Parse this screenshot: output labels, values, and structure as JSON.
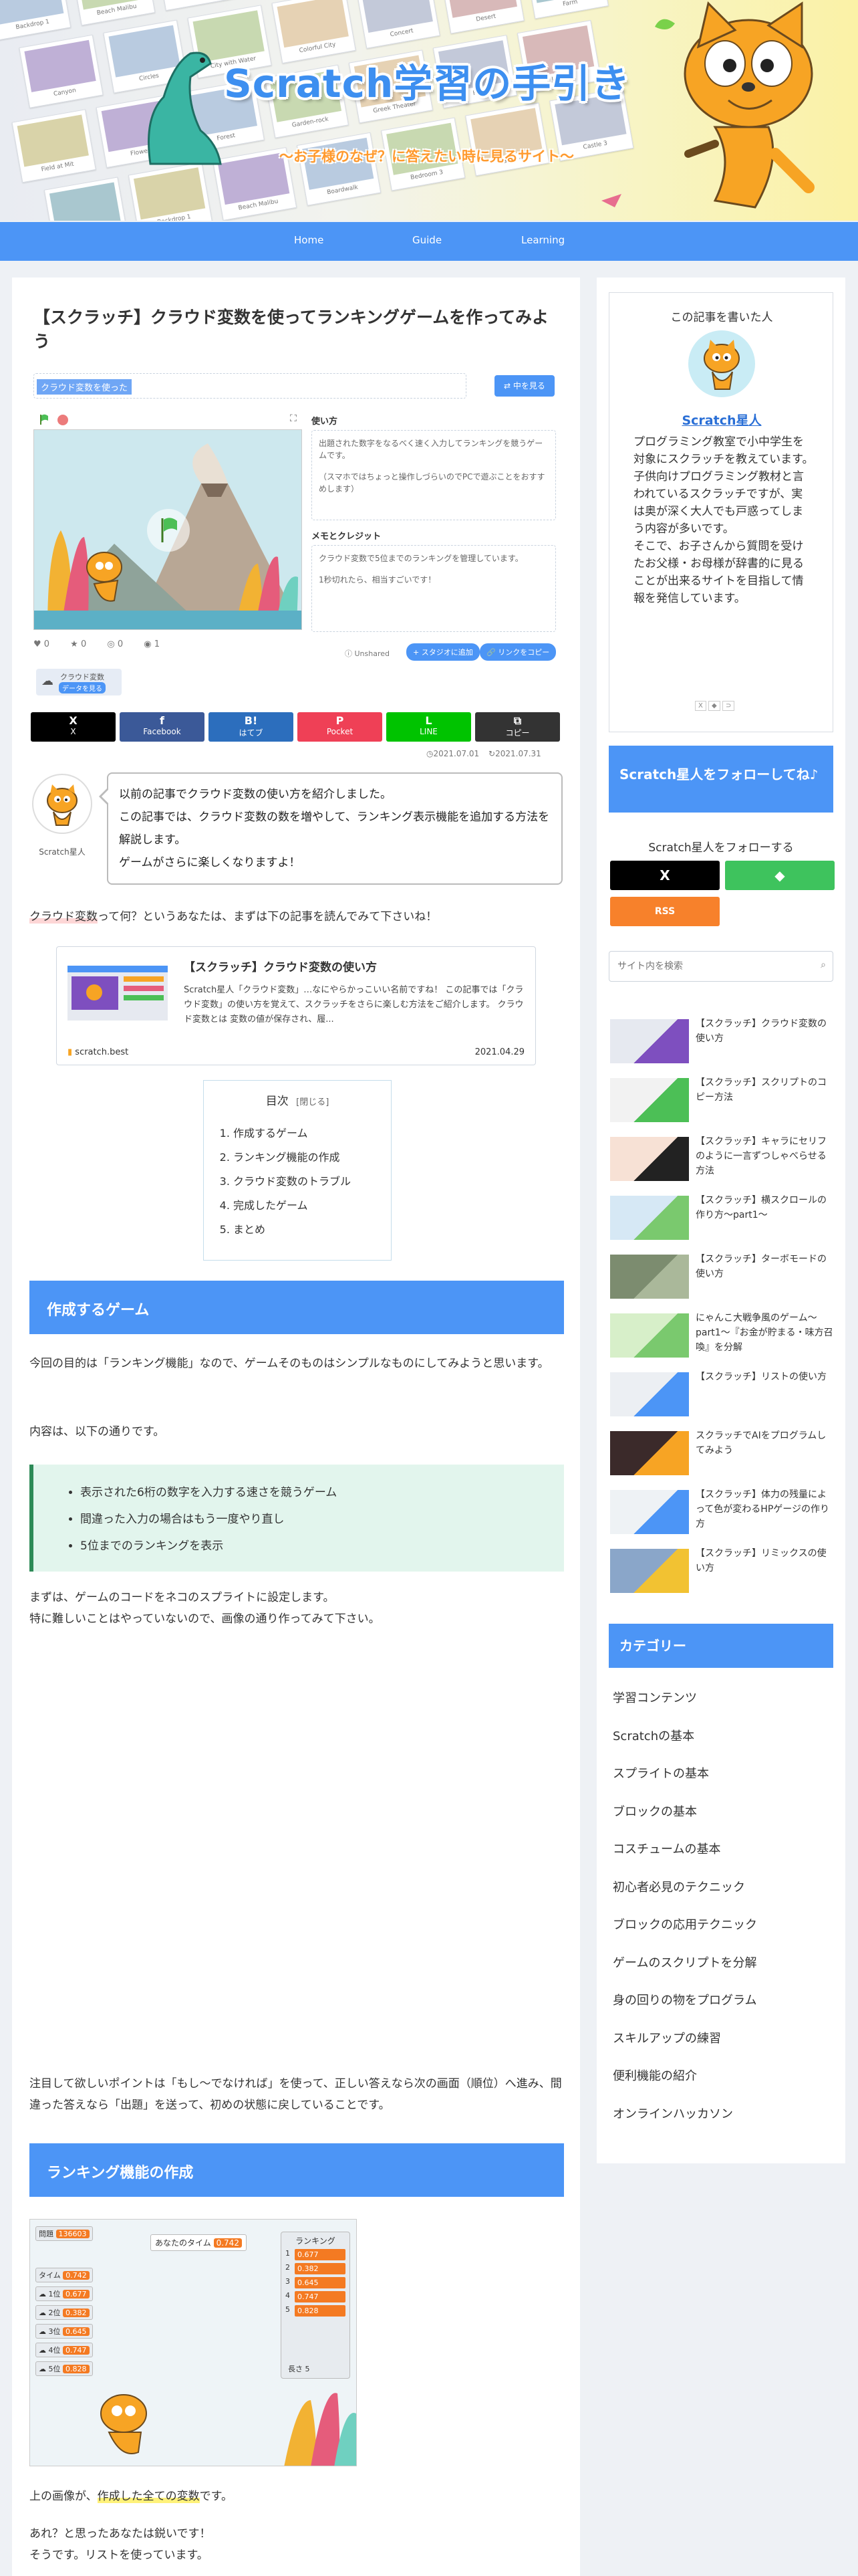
{
  "header": {
    "title": "Scratch学習の手引き",
    "subtitle": "～お子様のなぜ？に答えたい時に見るサイト～",
    "nav": [
      "Home",
      "Guide",
      "Learning"
    ],
    "tile_labels": [
      "Backdrop 1",
      "Beach Malibu",
      "Boardwalk",
      "Bedroom 3",
      "Castle 4",
      "Castle 3",
      "Chalkboard",
      "Canyon",
      "Circles",
      "City with Water",
      "Colorful City",
      "Concert",
      "Desert",
      "Farm",
      "Field at Mit",
      "Flowers",
      "Forest",
      "Garden-rock",
      "Greek Theater",
      "Hall",
      "Jurassic",
      "Light"
    ]
  },
  "article": {
    "title": "【スクラッチ】クラウド変数を使ってランキングゲームを作ってみよう",
    "embed": {
      "project_name": "ランキング",
      "selected_text": "クラウド変数を使った",
      "remix_label": "中を見る",
      "instructions_title": "使い方",
      "instructions_text": "出題された数字をなるべく速く入力してランキングを競うゲームです。",
      "instructions_note": "（スマホではちょっと操作しづらいのでPCで遊ぶことをおすすめします）",
      "credits_title": "メモとクレジット",
      "credits_text": "クラウド変数で5位までのランキングを管理しています。",
      "credits_note": "1秒切れたら、相当すごいです！",
      "stats": [
        "0",
        "0",
        "0",
        "1"
      ],
      "unshared": "Unshared",
      "studio_button": "スタジオに追加",
      "copy_link_button": "リンクをコピー",
      "tag": "クラウド変数",
      "tag_sub": "データを見る"
    },
    "share": [
      {
        "icon": "X",
        "label": "X",
        "color": "#000000"
      },
      {
        "icon": "f",
        "label": "Facebook",
        "color": "#3b5998"
      },
      {
        "icon": "B!",
        "label": "はてブ",
        "color": "#2c6ebd"
      },
      {
        "icon": "P",
        "label": "Pocket",
        "color": "#ef4056"
      },
      {
        "icon": "L",
        "label": "LINE",
        "color": "#00c300"
      },
      {
        "icon": "⧉",
        "label": "コピー",
        "color": "#333333"
      }
    ],
    "date_posted": "2021.07.01",
    "date_updated": "2021.07.31",
    "speaker_name": "Scratch星人",
    "bubble": [
      "以前の記事でクラウド変数の使い方を紹介しました。",
      "この記事では、クラウド変数の数を増やして、ランキング表示機能を追加する方法を解説します。",
      "ゲームがさらに楽しくなりますよ！"
    ],
    "intro_highlight": "クラウド変数",
    "intro_rest": "って何？というあなたは、まずは下の記事を読んでみて下さいね！",
    "card": {
      "title": "【スクラッチ】クラウド変数の使い方",
      "excerpt": "Scratch星人「クラウド変数」…なにやらかっこいい名前ですね！ この記事では「クラウド変数」の使い方を覚えて、スクラッチをさらに楽しむ方法をご紹介します。 クラウド変数とは 変数の値が保存され、履...",
      "domain": "scratch.best",
      "date": "2021.04.29"
    },
    "toc": {
      "title": "目次",
      "toggle": "[閉じる]",
      "items": [
        "作成するゲーム",
        "ランキング機能の作成",
        "クラウド変数のトラブル",
        "完成したゲーム",
        "まとめ"
      ]
    },
    "h2_1": "作成するゲーム",
    "p1": "今回の目的は「ランキング機能」なので、ゲームそのものはシンプルなものにしてみようと思います。",
    "p2": "内容は、以下の通りです。",
    "bullets": [
      "表示された6桁の数字を入力する速さを競うゲーム",
      "間違った入力の場合はもう一度やり直し",
      "5位までのランキングを表示"
    ],
    "p3a": "まずは、ゲームのコードをネコのスプライトに設定します。",
    "p3b": "特に難しいことはやっていないので、画像の通り作ってみて下さい。",
    "p4": "注目して欲しいポイントは「もし～でなければ」を使って、正しい答えなら次の画面（順位）へ進み、間違った答えなら「出題」を送って、初めの状態に戻していることです。",
    "h2_2": "ランキング機能の作成",
    "shot": {
      "q_label": "問題",
      "q_value": "136603",
      "your_time_label": "あなたのタイム",
      "your_time_value": "0.742",
      "time_label": "タイム",
      "time_value": "0.742",
      "ranking_title": "ランキング",
      "ranks": [
        {
          "n": "1",
          "v": "0.677"
        },
        {
          "n": "2",
          "v": "0.382"
        },
        {
          "n": "3",
          "v": "0.645"
        },
        {
          "n": "4",
          "v": "0.747"
        },
        {
          "n": "5",
          "v": "0.828"
        }
      ],
      "left_rows": [
        {
          "label": "1位",
          "value": "0.677"
        },
        {
          "label": "2位",
          "value": "0.382"
        },
        {
          "label": "3位",
          "value": "0.645"
        },
        {
          "label": "4位",
          "value": "0.747"
        },
        {
          "label": "5位",
          "value": "0.828"
        }
      ],
      "length_label": "長さ 5"
    },
    "p5_pre": "上の画像が、",
    "p5_hl": "作成した全ての変数",
    "p5_post": "です。",
    "p6": "あれ？と思ったあなたは鋭いです！",
    "p7": "そうです。リストを使っています。"
  },
  "sidebar": {
    "author_heading": "この記事を書いた人",
    "author_name": "Scratch星人",
    "author_bio_1": "プログラミング教室で小中学生を対象にスクラッチを教えています。",
    "author_bio_2": "子供向けプログラミング教材と言われているスクラッチですが、実は奥が深く大人でも戸惑ってしまう内容が多いです。",
    "author_bio_3": "そこで、お子さんから質問を受けたお父様・お母様が辞書的に見ることが出来るサイトを目指して情報を発信しています。",
    "follow_heading": "Scratch星人をフォローしてね♪",
    "follow_text": "Scratch星人をフォローする",
    "follow_buttons": [
      {
        "icon": "X",
        "color": "#000000"
      },
      {
        "icon": "◆",
        "color": "#3ec35d"
      },
      {
        "icon": "RSS",
        "color": "#f7812b"
      }
    ],
    "search_placeholder": "サイト内を検索",
    "posts": [
      "【スクラッチ】クラウド変数の使い方",
      "【スクラッチ】スクリプトのコピー方法",
      "【スクラッチ】キャラにセリフのように一言ずつしゃべらせる方法",
      "【スクラッチ】横スクロールの作り方～part1～",
      "【スクラッチ】ターボモードの使い方",
      "にゃんこ大戦争風のゲーム～part1～『お金が貯まる・味方召喚』を分解",
      "【スクラッチ】リストの使い方",
      "スクラッチでAIをプログラムしてみよう",
      "【スクラッチ】体力の残量によって色が変わるHPゲージの作り方",
      "【スクラッチ】リミックスの使い方"
    ],
    "category_heading": "カテゴリー",
    "categories": [
      "学習コンテンツ",
      "Scratchの基本",
      "スプライトの基本",
      "ブロックの基本",
      "コスチュームの基本",
      "初心者必見のテクニック",
      "ブロックの応用テクニック",
      "ゲームのスクリプトを分解",
      "身の回りの物をプログラム",
      "スキルアップの練習",
      "便利機能の紹介",
      "オンラインハッカソン"
    ]
  }
}
